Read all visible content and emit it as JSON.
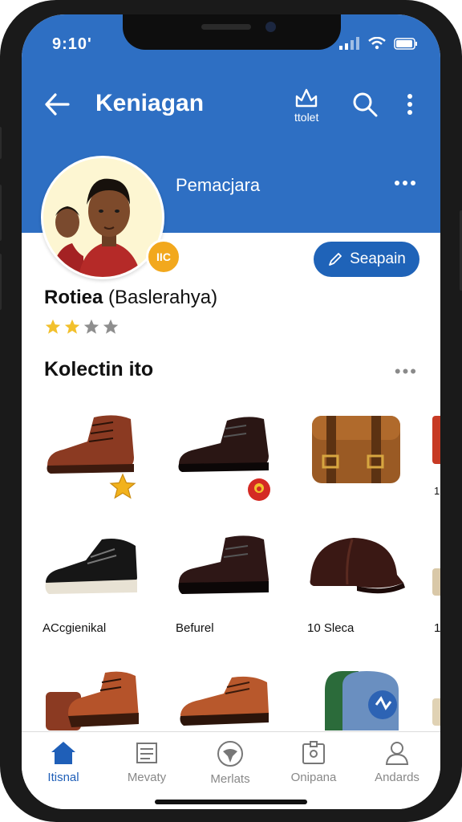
{
  "status": {
    "time": "9:10'"
  },
  "topbar": {
    "title": "Keniagan",
    "action_label": "ttolet"
  },
  "profile": {
    "header_name": "Pemacjara",
    "badge_text": "IIC",
    "name_bold": "Rotiea",
    "name_rest": " (Baslerahya)",
    "rating": {
      "filled": 2,
      "total": 4
    },
    "action_button": "Seapain"
  },
  "collection": {
    "title": "Kolectin ito",
    "item_labels": [
      "ACcgienikal",
      "Befurel",
      "10 Sleca",
      "1"
    ]
  },
  "colors": {
    "header": "#2e6fc3",
    "accent": "#1f5fb8",
    "star": "#f2c02c"
  },
  "nav": {
    "items": [
      {
        "label": "Itisnal",
        "icon": "home-icon"
      },
      {
        "label": "Mevaty",
        "icon": "list-icon"
      },
      {
        "label": "Merlats",
        "icon": "circle-emblem-icon"
      },
      {
        "label": "Onipana",
        "icon": "badge-icon"
      },
      {
        "label": "Andards",
        "icon": "person-icon"
      }
    ]
  }
}
